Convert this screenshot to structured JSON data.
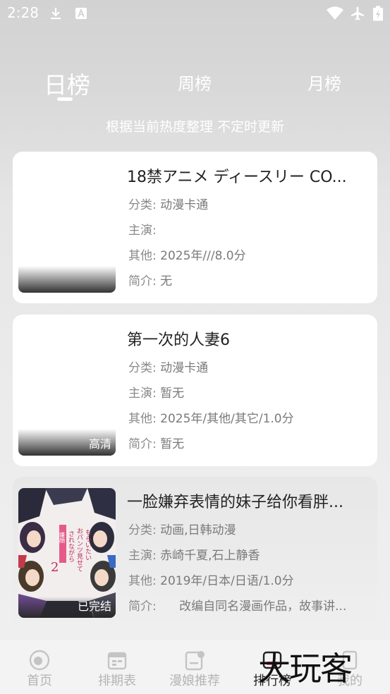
{
  "status_bar": {
    "time": "2:28"
  },
  "tabs": [
    {
      "label": "日榜",
      "active": true
    },
    {
      "label": "周榜",
      "active": false
    },
    {
      "label": "月榜",
      "active": false
    }
  ],
  "subtitle": "根据当前热度整理 不定时更新",
  "meta_labels": {
    "category": "分类:",
    "cast": "主演:",
    "other": "其他:",
    "intro": "简介:"
  },
  "items": [
    {
      "title": "18禁アニメ ディースリー CO...",
      "category": "动漫卡通",
      "cast": "",
      "other": "2025年///8.0分",
      "intro": "无",
      "badge": ""
    },
    {
      "title": "第一次的人妻6",
      "category": "动漫卡通",
      "cast": "暂无",
      "other": "2025年/其他/其它/1.0分",
      "intro": "暂无",
      "badge": "高清"
    },
    {
      "title": "一脸嫌弃表情的妹子给你看胖...",
      "category": "动画,日韩动漫",
      "cast": "赤崎千夏,石上静香",
      "other": "2019年/日本/日语/1.0分",
      "intro": "      改编自同名漫画作品，故事讲...",
      "badge": "已完结"
    }
  ],
  "bottom_nav": [
    {
      "label": "首页",
      "icon": "home-icon",
      "active": false
    },
    {
      "label": "排期表",
      "icon": "calendar-icon",
      "active": false
    },
    {
      "label": "漫娘推荐",
      "icon": "recommend-icon",
      "active": false
    },
    {
      "label": "排行榜",
      "icon": "ranking-icon",
      "active": true
    },
    {
      "label": "我的",
      "icon": "profile-icon",
      "active": false
    }
  ],
  "watermark": "大玩客",
  "colors": {
    "accent": "#ff5a7a",
    "text_primary": "#222222",
    "text_secondary": "#8a8a8a"
  }
}
